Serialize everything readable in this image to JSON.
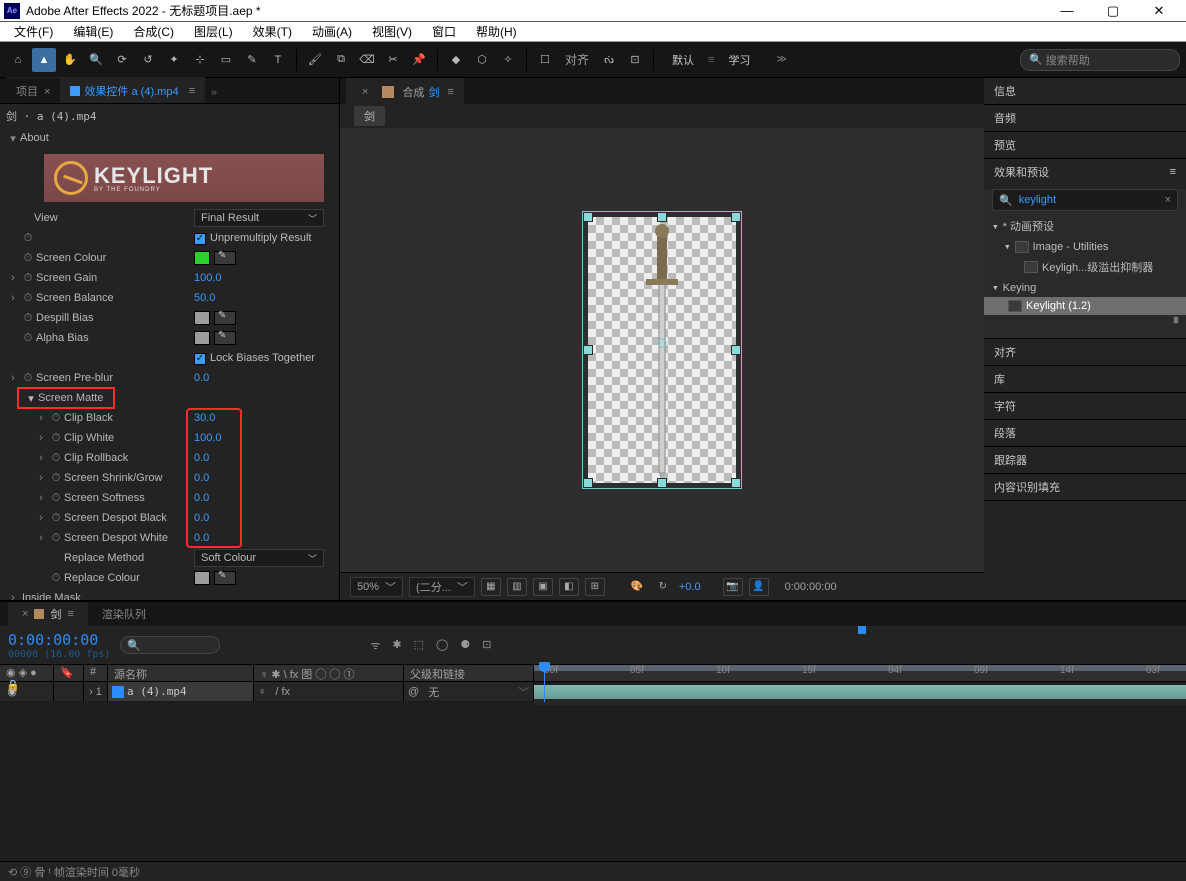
{
  "title": "Adobe After Effects 2022 - 无标题项目.aep *",
  "menu": [
    "文件(F)",
    "编辑(E)",
    "合成(C)",
    "图层(L)",
    "效果(T)",
    "动画(A)",
    "视图(V)",
    "窗口",
    "帮助(H)"
  ],
  "toolbar": {
    "align": "对齐",
    "workspace_default": "默认",
    "workspace_learn": "学习",
    "search_placeholder": "搜索帮助"
  },
  "leftPanel": {
    "tab_project": "项目",
    "tab_fx": "效果控件 a (4).mp4",
    "source_line": "剑 · a (4).mp4",
    "about": "About",
    "logo_text": "KEYLIGHT",
    "logo_sub": "BY THE FOUNDRY",
    "view_label": "View",
    "view_value": "Final Result",
    "unpremult": "Unpremultiply Result",
    "params": {
      "screen_colour": {
        "label": "Screen Colour",
        "swatch": "#2bd12b"
      },
      "screen_gain": {
        "label": "Screen Gain",
        "value": "100.0"
      },
      "screen_balance": {
        "label": "Screen Balance",
        "value": "50.0"
      },
      "despill_bias": {
        "label": "Despill Bias",
        "swatch": "#9c9c9c"
      },
      "alpha_bias": {
        "label": "Alpha Bias",
        "swatch": "#9c9c9c"
      },
      "lock_biases": "Lock Biases Together",
      "screen_preblur": {
        "label": "Screen Pre-blur",
        "value": "0.0"
      },
      "screen_matte": "Screen Matte",
      "clip_black": {
        "label": "Clip Black",
        "value": "30.0"
      },
      "clip_white": {
        "label": "Clip White",
        "value": "100.0"
      },
      "clip_rollback": {
        "label": "Clip Rollback",
        "value": "0.0"
      },
      "shrink_grow": {
        "label": "Screen Shrink/Grow",
        "value": "0.0"
      },
      "softness": {
        "label": "Screen Softness",
        "value": "0.0"
      },
      "despot_black": {
        "label": "Screen Despot Black",
        "value": "0.0"
      },
      "despot_white": {
        "label": "Screen Despot White",
        "value": "0.0"
      },
      "replace_method": {
        "label": "Replace Method",
        "value": "Soft Colour"
      },
      "replace_colour": {
        "label": "Replace Colour",
        "swatch": "#9c9c9c"
      },
      "inside_mask": "Inside Mask"
    }
  },
  "viewer": {
    "tab_prefix": "合成",
    "tab_name": "剑",
    "crumb": "剑",
    "zoom": "50%",
    "res": "(二分...",
    "exposure": "+0.0",
    "time": "0:00:00:00"
  },
  "rightPanels": {
    "info": "信息",
    "audio": "音频",
    "preview": "预览",
    "fxpresets": "效果和预设",
    "search": "keylight",
    "tree": {
      "anim": "* 动画预设",
      "imgutil": "Image - Utilities",
      "keylight_spill": "Keyligh...级溢出抑制器",
      "keying": "Keying",
      "keylight12": "Keylight (1.2)"
    },
    "align": "对齐",
    "lib": "库",
    "char": "字符",
    "para": "段落",
    "tracker": "跟踪器",
    "contentaware": "内容识别填充"
  },
  "timeline": {
    "tab_comp": "剑",
    "tab_render": "渲染队列",
    "timecode": "0:00:00:00",
    "tc_sub": "00000 (16.00 fps)",
    "col_source": "源名称",
    "col_switches": "♀ ✱ \\ fx 图 ◯ ◯ ①",
    "col_parent": "父级和链接",
    "layer_num": "1",
    "layer_name": "a (4).mp4",
    "parent_none": "无",
    "ticks": [
      "00f",
      "05f",
      "10f",
      "15f",
      "04f",
      "09f",
      "14f",
      "03f"
    ],
    "foot_left": "⟲ ⑨ 骨 ᵗ   帧渲染时间  0毫秒"
  }
}
